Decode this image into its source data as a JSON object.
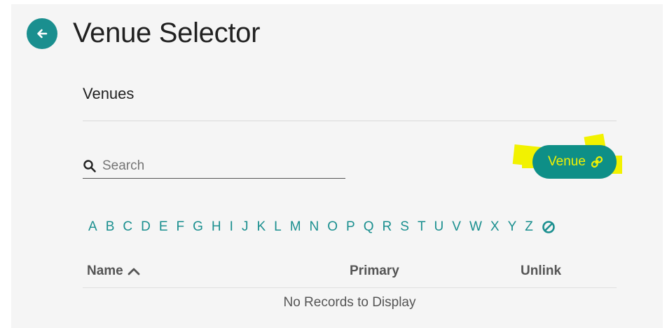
{
  "page": {
    "title": "Venue Selector",
    "back_icon": "arrow-left-icon"
  },
  "section": {
    "title": "Venues"
  },
  "search": {
    "placeholder": "Search",
    "value": "",
    "icon": "search-icon"
  },
  "venue_button": {
    "label": "Venue",
    "icon": "link-icon"
  },
  "alphabet": [
    "A",
    "B",
    "C",
    "D",
    "E",
    "F",
    "G",
    "H",
    "I",
    "J",
    "K",
    "L",
    "M",
    "N",
    "O",
    "P",
    "Q",
    "R",
    "S",
    "T",
    "U",
    "V",
    "W",
    "X",
    "Y",
    "Z"
  ],
  "alphabet_clear_icon": "clear-filter-icon",
  "table": {
    "columns": [
      "Name",
      "Primary",
      "Unlink"
    ],
    "sort_icon": "chevron-up-icon",
    "empty_message": "No Records to Display"
  },
  "colors": {
    "accent": "#1a8f8f",
    "button_bg": "#0e8f87",
    "highlight": "#f2f200",
    "panel_bg": "#f5f5f5"
  }
}
